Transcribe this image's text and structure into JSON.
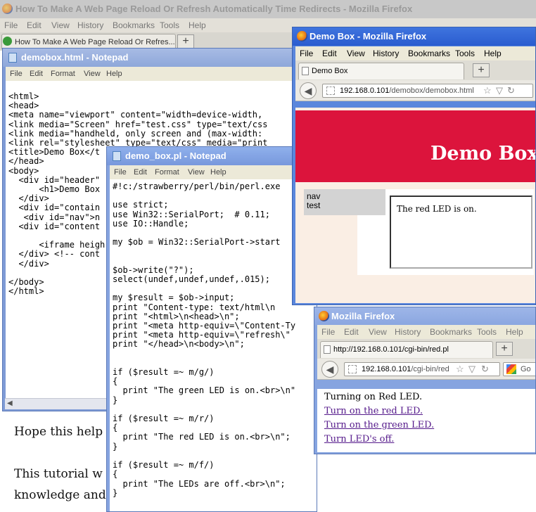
{
  "background_browser": {
    "title": "How To Make A Web Page Reload Or Refresh Automatically Time Redirects - Mozilla Firefox",
    "menu": [
      "File",
      "Edit",
      "View",
      "History",
      "Bookmarks",
      "Tools",
      "Help"
    ],
    "tab_label": "How To Make A Web Page Reload Or Refres...",
    "new_tab": "+",
    "content_lines": [
      "Hope this help",
      "This tutorial w",
      "knowledge and"
    ]
  },
  "notepad_html": {
    "title": "demobox.html - Notepad",
    "menu": [
      "File",
      "Edit",
      "Format",
      "View",
      "Help"
    ],
    "code": "<html>\n<head>\n<meta name=\"viewport\" content=\"width=device-width,\n<link media=\"Screen\" href=\"test.css\" type=\"text/css\n<link media=\"handheld, only screen and (max-width:\n<link rel=\"stylesheet\" type=\"text/css\" media=\"print\n<title>Demo Box</t\n</head>\n<body>\n  <div id=\"header\"\n      <h1>Demo Box\n  </div>\n  <div id=\"contain\n   <div id=\"nav\">n\n  <div id=\"content\n\n      <iframe heigh\n  </div> <!-- cont\n  </div>\n\n</body>\n</html>"
  },
  "notepad_perl": {
    "title": "demo_box.pl - Notepad",
    "menu": [
      "File",
      "Edit",
      "Format",
      "View",
      "Help"
    ],
    "code": "#!c:/strawberry/perl/bin/perl.exe\n\nuse strict;\nuse Win32::SerialPort;  # 0.11;\nuse IO::Handle;\n\nmy $ob = Win32::SerialPort->start\n\n\n$ob->write(\"?\");\nselect(undef,undef,undef,.015);\n\nmy $result = $ob->input;\nprint \"Content-type: text/html\\n\nprint \"<html>\\n<head>\\n\";\nprint \"<meta http-equiv=\\\"Content-Ty\nprint \"<meta http-equiv=\\\"refresh\\\"\nprint \"</head>\\n<body>\\n\";\n\n\nif ($result =~ m/g/)\n{\n  print \"The green LED is on.<br>\\n\"\n}\n\nif ($result =~ m/r/)\n{\n  print \"The red LED is on.<br>\\n\";\n}\n\nif ($result =~ m/f/)\n{\n  print \"The LEDs are off.<br>\\n\";\n}"
  },
  "demo_browser": {
    "title": "Demo Box - Mozilla Firefox",
    "menu": [
      "File",
      "Edit",
      "View",
      "History",
      "Bookmarks",
      "Tools",
      "Help"
    ],
    "tab_label": "Demo Box",
    "new_tab": "+",
    "url_host": "192.168.0.101",
    "url_path": "/demobox/demobox.html",
    "page": {
      "heading": "Demo Box",
      "nav_lines": [
        "nav",
        "test"
      ],
      "iframe_text": "The red LED is on."
    },
    "colors": {
      "header": "#dc143c",
      "page_bg": "#faeee4",
      "nav_bg": "#d3d3d3"
    }
  },
  "led_browser": {
    "title": "Mozilla Firefox",
    "menu": [
      "File",
      "Edit",
      "View",
      "History",
      "Bookmarks",
      "Tools",
      "Help"
    ],
    "tab_label": "http://192.168.0.101/cgi-bin/red.pl",
    "new_tab": "+",
    "url_host": "192.168.0.101",
    "url_path": "/cgi-bin/red",
    "search_label": "Go",
    "page": {
      "status": "Turning on Red LED.",
      "links": [
        "Turn on the red LED.",
        "Turn on the green LED.",
        "Turn LED's off."
      ]
    }
  }
}
